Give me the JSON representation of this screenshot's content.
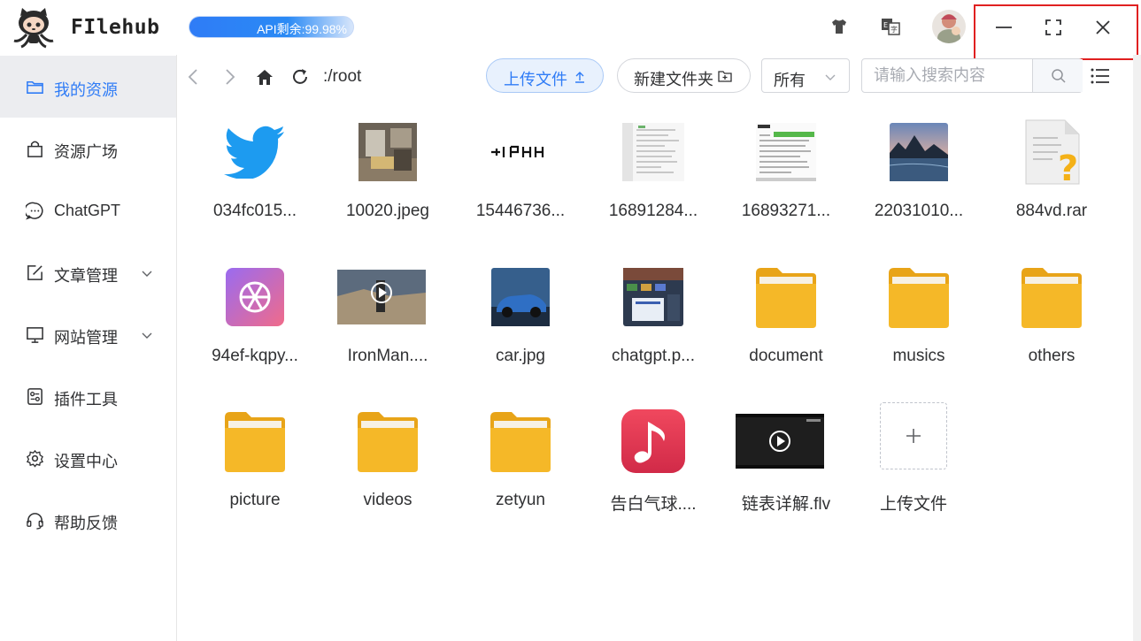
{
  "app": {
    "title": "FIlehub",
    "api_badge": "API剩余:99.98%"
  },
  "sidebar": {
    "items": [
      {
        "label": "我的资源",
        "icon": "folder-icon",
        "active": true
      },
      {
        "label": "资源广场",
        "icon": "shopping-bag-icon"
      },
      {
        "label": "ChatGPT",
        "icon": "chat-bubble-icon"
      },
      {
        "label": "文章管理",
        "icon": "edit-icon",
        "expandable": true
      },
      {
        "label": "网站管理",
        "icon": "monitor-icon",
        "expandable": true
      },
      {
        "label": "插件工具",
        "icon": "plugin-icon"
      },
      {
        "label": "设置中心",
        "icon": "gear-icon"
      },
      {
        "label": "帮助反馈",
        "icon": "headset-icon"
      }
    ]
  },
  "toolbar": {
    "path": ":/root",
    "upload_label": "上传文件",
    "new_folder_label": "新建文件夹",
    "filter_value": "所有",
    "search_placeholder": "请输入搜索内容"
  },
  "files": [
    {
      "name": "034fc015...",
      "kind": "twitter-logo"
    },
    {
      "name": "10020.jpeg",
      "kind": "photo-room"
    },
    {
      "name": "15446736...",
      "kind": "text-image"
    },
    {
      "name": "16891284...",
      "kind": "screenshot-doc"
    },
    {
      "name": "16893271...",
      "kind": "screenshot-green"
    },
    {
      "name": "22031010...",
      "kind": "photo-lake"
    },
    {
      "name": "884vd.rar",
      "kind": "unknown-file"
    },
    {
      "name": "94ef-kqpy...",
      "kind": "openai-logo"
    },
    {
      "name": "IronMan....",
      "kind": "video"
    },
    {
      "name": "car.jpg",
      "kind": "photo-car"
    },
    {
      "name": "chatgpt.p...",
      "kind": "screenshot-dark"
    },
    {
      "name": "document",
      "kind": "folder"
    },
    {
      "name": "musics",
      "kind": "folder"
    },
    {
      "name": "others",
      "kind": "folder"
    },
    {
      "name": "picture",
      "kind": "folder"
    },
    {
      "name": "videos",
      "kind": "folder"
    },
    {
      "name": "zetyun",
      "kind": "folder"
    },
    {
      "name": "告白气球....",
      "kind": "music"
    },
    {
      "name": "链表详解.flv",
      "kind": "video-dark"
    },
    {
      "name": "上传文件",
      "kind": "upload-tile"
    }
  ],
  "colors": {
    "accent": "#2f7cf6",
    "highlight_frame": "#e02020",
    "folder": "#f3b423"
  }
}
